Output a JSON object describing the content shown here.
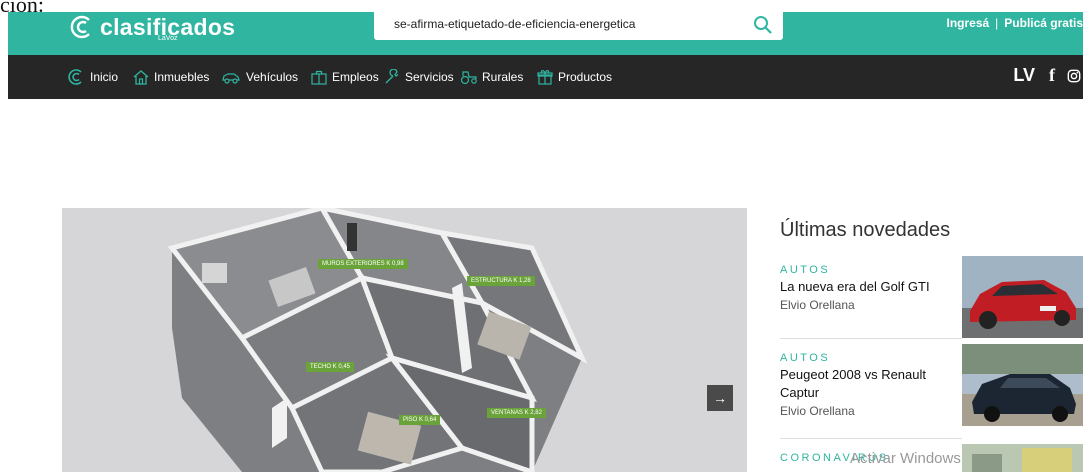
{
  "clipped_text": "ción:",
  "header": {
    "logo_text": "clasificados",
    "logo_sub": "LaVoz",
    "search_value": "se-afirma-etiquetado-de-eficiencia-energetica",
    "login_label": "Ingresá",
    "separator": "|",
    "publish_label": "Publicá gratis",
    "brand_color": "#2fb5a0"
  },
  "nav": {
    "items": [
      {
        "label": "Inicio",
        "icon": "clasificados-icon"
      },
      {
        "label": "Inmuebles",
        "icon": "house-icon"
      },
      {
        "label": "Vehículos",
        "icon": "car-icon"
      },
      {
        "label": "Empleos",
        "icon": "briefcase-icon"
      },
      {
        "label": "Servicios",
        "icon": "wrench-icon"
      },
      {
        "label": "Rurales",
        "icon": "tractor-icon"
      },
      {
        "label": "Productos",
        "icon": "gift-icon"
      }
    ],
    "social": {
      "lv": "LV",
      "facebook": "f",
      "instagram": "instagram-icon"
    }
  },
  "hero": {
    "tags": [
      "MUROS EXTERIORES K 0,98",
      "ESTRUCTURA K 1,28",
      "TECHO K 0,45",
      "PISO K 0,64",
      "VENTANAS K 2,82"
    ],
    "next_symbol": "→"
  },
  "sidebar": {
    "title": "Últimas novedades",
    "cards": [
      {
        "category": "AUTOS",
        "headline": "La nueva era del Golf GTI",
        "author": "Elvio Orellana"
      },
      {
        "category": "AUTOS",
        "headline": "Peugeot 2008 vs Renault Captur",
        "author": "Elvio Orellana"
      },
      {
        "category": "CORONAVIRUS",
        "headline": "",
        "author": ""
      }
    ]
  },
  "watermark": "Activar Windows"
}
